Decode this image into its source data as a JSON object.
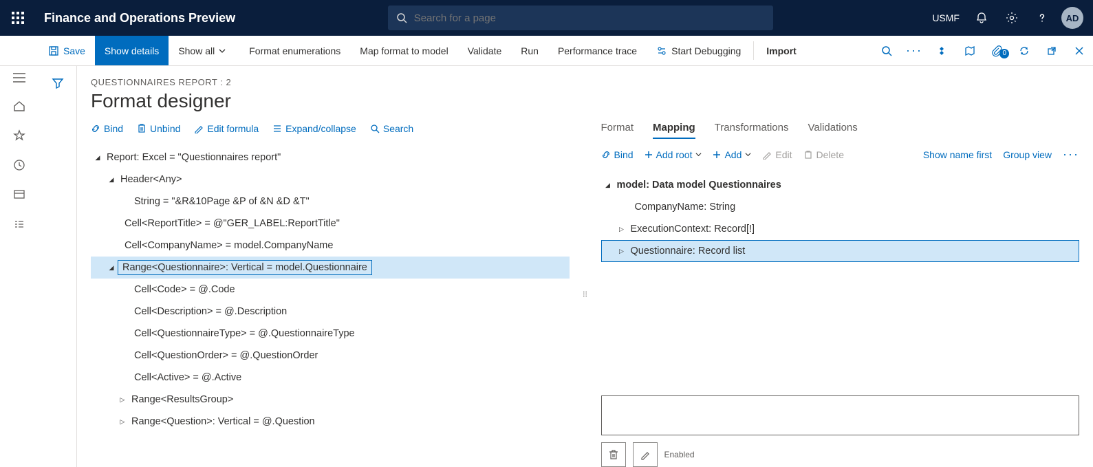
{
  "topbar": {
    "app_title": "Finance and Operations Preview",
    "search_placeholder": "Search for a page",
    "company": "USMF",
    "avatar": "AD"
  },
  "cmdbar": {
    "save": "Save",
    "show_details": "Show details",
    "show_all": "Show all",
    "format_enum": "Format enumerations",
    "map_format": "Map format to model",
    "validate": "Validate",
    "run": "Run",
    "perf_trace": "Performance trace",
    "start_debug": "Start Debugging",
    "import": "Import",
    "badge_count": "0"
  },
  "page": {
    "breadcrumb": "QUESTIONNAIRES REPORT : 2",
    "title": "Format designer"
  },
  "left_toolbar": {
    "bind": "Bind",
    "unbind": "Unbind",
    "edit_formula": "Edit formula",
    "expand_collapse": "Expand/collapse",
    "search": "Search"
  },
  "left_tree": {
    "n0": "Report: Excel = \"Questionnaires report\"",
    "n1": "Header<Any>",
    "n2": "String = \"&R&10Page &P of &N &D &T\"",
    "n3": "Cell<ReportTitle> = @\"GER_LABEL:ReportTitle\"",
    "n4": "Cell<CompanyName> = model.CompanyName",
    "n5": "Range<Questionnaire>: Vertical = model.Questionnaire",
    "n6": "Cell<Code> = @.Code",
    "n7": "Cell<Description> = @.Description",
    "n8": "Cell<QuestionnaireType> = @.QuestionnaireType",
    "n9": "Cell<QuestionOrder> = @.QuestionOrder",
    "n10": "Cell<Active> = @.Active",
    "n11": "Range<ResultsGroup>",
    "n12": "Range<Question>: Vertical = @.Question"
  },
  "right_tabs": {
    "format": "Format",
    "mapping": "Mapping",
    "transformations": "Transformations",
    "validations": "Validations"
  },
  "right_toolbar": {
    "bind": "Bind",
    "add_root": "Add root",
    "add": "Add",
    "edit": "Edit",
    "delete": "Delete",
    "show_name_first": "Show name first",
    "group_view": "Group view"
  },
  "right_tree": {
    "n0": "model: Data model Questionnaires",
    "n1": "CompanyName: String",
    "n2": "ExecutionContext: Record[!]",
    "n3": "Questionnaire: Record list"
  },
  "formula": {
    "enabled_label": "Enabled"
  }
}
